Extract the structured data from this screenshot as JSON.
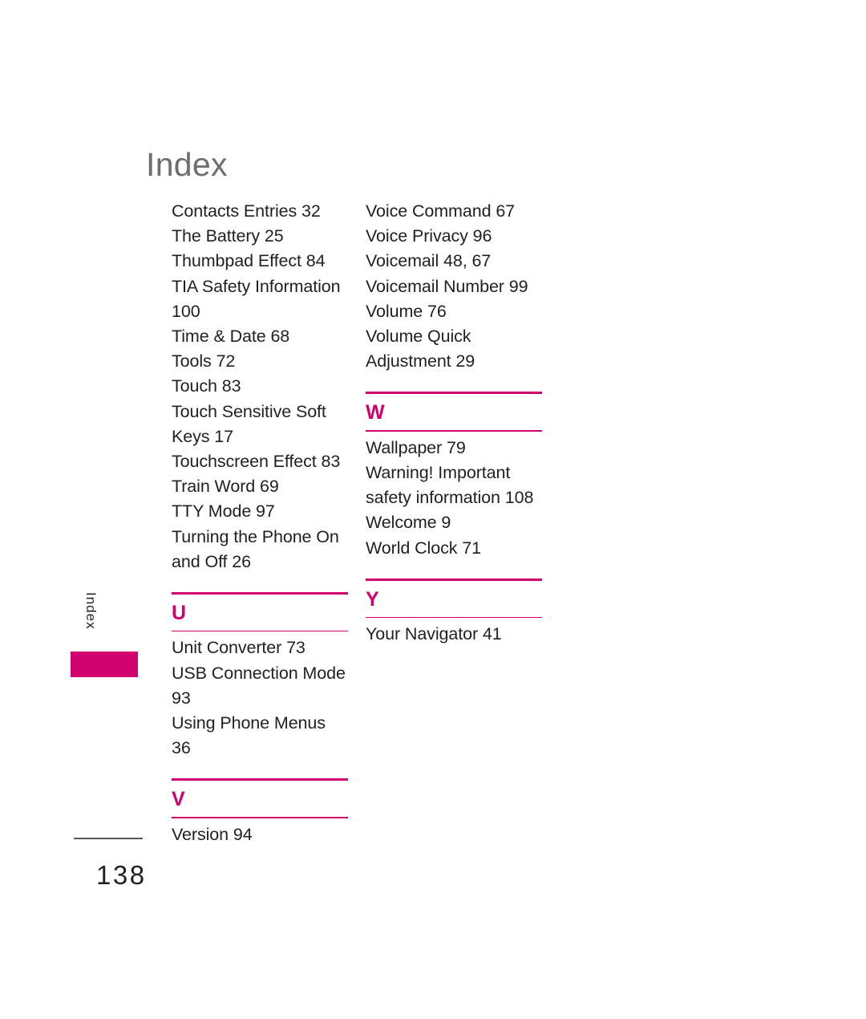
{
  "document": {
    "title": "Index",
    "page_number": "138",
    "side_tab_label": "Index",
    "accent_color": "#d0006f",
    "title_color": "#6e6e6e",
    "text_color": "#231f20"
  },
  "columns": {
    "left": {
      "leading_entries": [
        "Contacts Entries 32",
        "The Battery 25",
        "Thumbpad Effect 84",
        "TIA Safety Information 100",
        "Time & Date 68",
        "Tools 72",
        "Touch 83",
        "Touch Sensitive Soft Keys 17",
        "Touchscreen Effect 83",
        "Train Word 69",
        "TTY Mode 97",
        "Turning the Phone On and Off 26"
      ],
      "sections": [
        {
          "letter": "U",
          "entries": [
            "Unit Converter 73",
            "USB Connection Mode 93",
            "Using Phone Menus 36"
          ]
        },
        {
          "letter": "V",
          "entries": [
            "Version 94"
          ]
        }
      ]
    },
    "right": {
      "leading_entries": [
        "Voice Command 67",
        "Voice Privacy 96",
        "Voicemail 48, 67",
        "Voicemail Number 99",
        "Volume 76",
        "Volume Quick Adjustment 29"
      ],
      "sections": [
        {
          "letter": "W",
          "entries": [
            "Wallpaper 79",
            "Warning! Important safety information 108",
            "Welcome 9",
            "World Clock 71"
          ]
        },
        {
          "letter": "Y",
          "entries": [
            "Your Navigator 41"
          ]
        }
      ]
    }
  }
}
